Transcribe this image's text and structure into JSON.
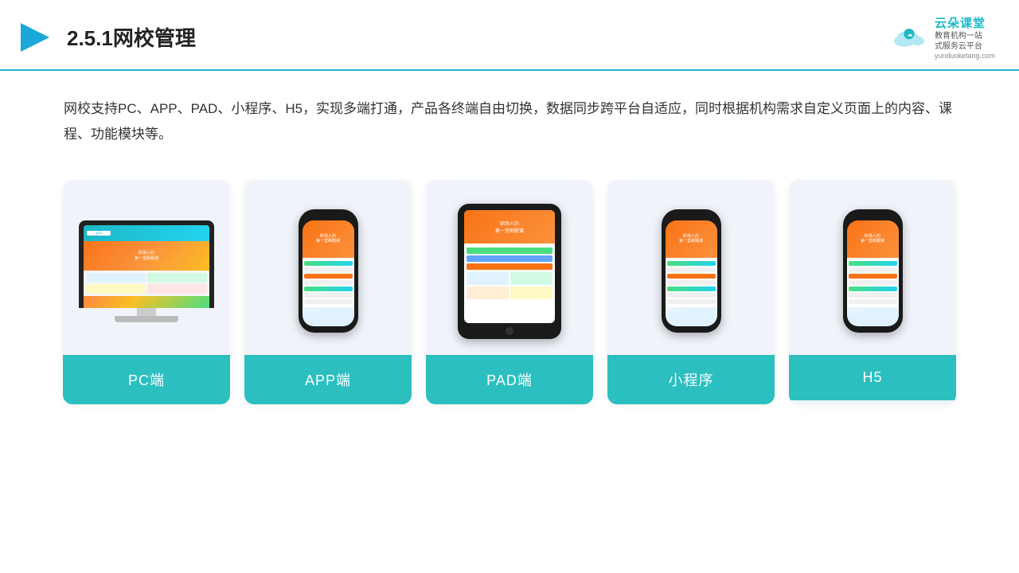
{
  "header": {
    "section_number": "2.5.1",
    "title": "网校管理",
    "brand": {
      "name_cn": "云朵课堂",
      "url": "yunduoketang.com",
      "tagline_line1": "教育机构一站",
      "tagline_line2": "式服务云平台"
    }
  },
  "description": {
    "text": "网校支持PC、APP、PAD、小程序、H5，实现多端打通，产品各终端自由切换，数据同步跨平台自适应，同时根据机构需求自定义页面上的内容、课程、功能模块等。"
  },
  "cards": [
    {
      "id": "pc",
      "label": "PC端"
    },
    {
      "id": "app",
      "label": "APP端"
    },
    {
      "id": "pad",
      "label": "PAD端"
    },
    {
      "id": "miniprogram",
      "label": "小程序"
    },
    {
      "id": "h5",
      "label": "H5"
    }
  ]
}
